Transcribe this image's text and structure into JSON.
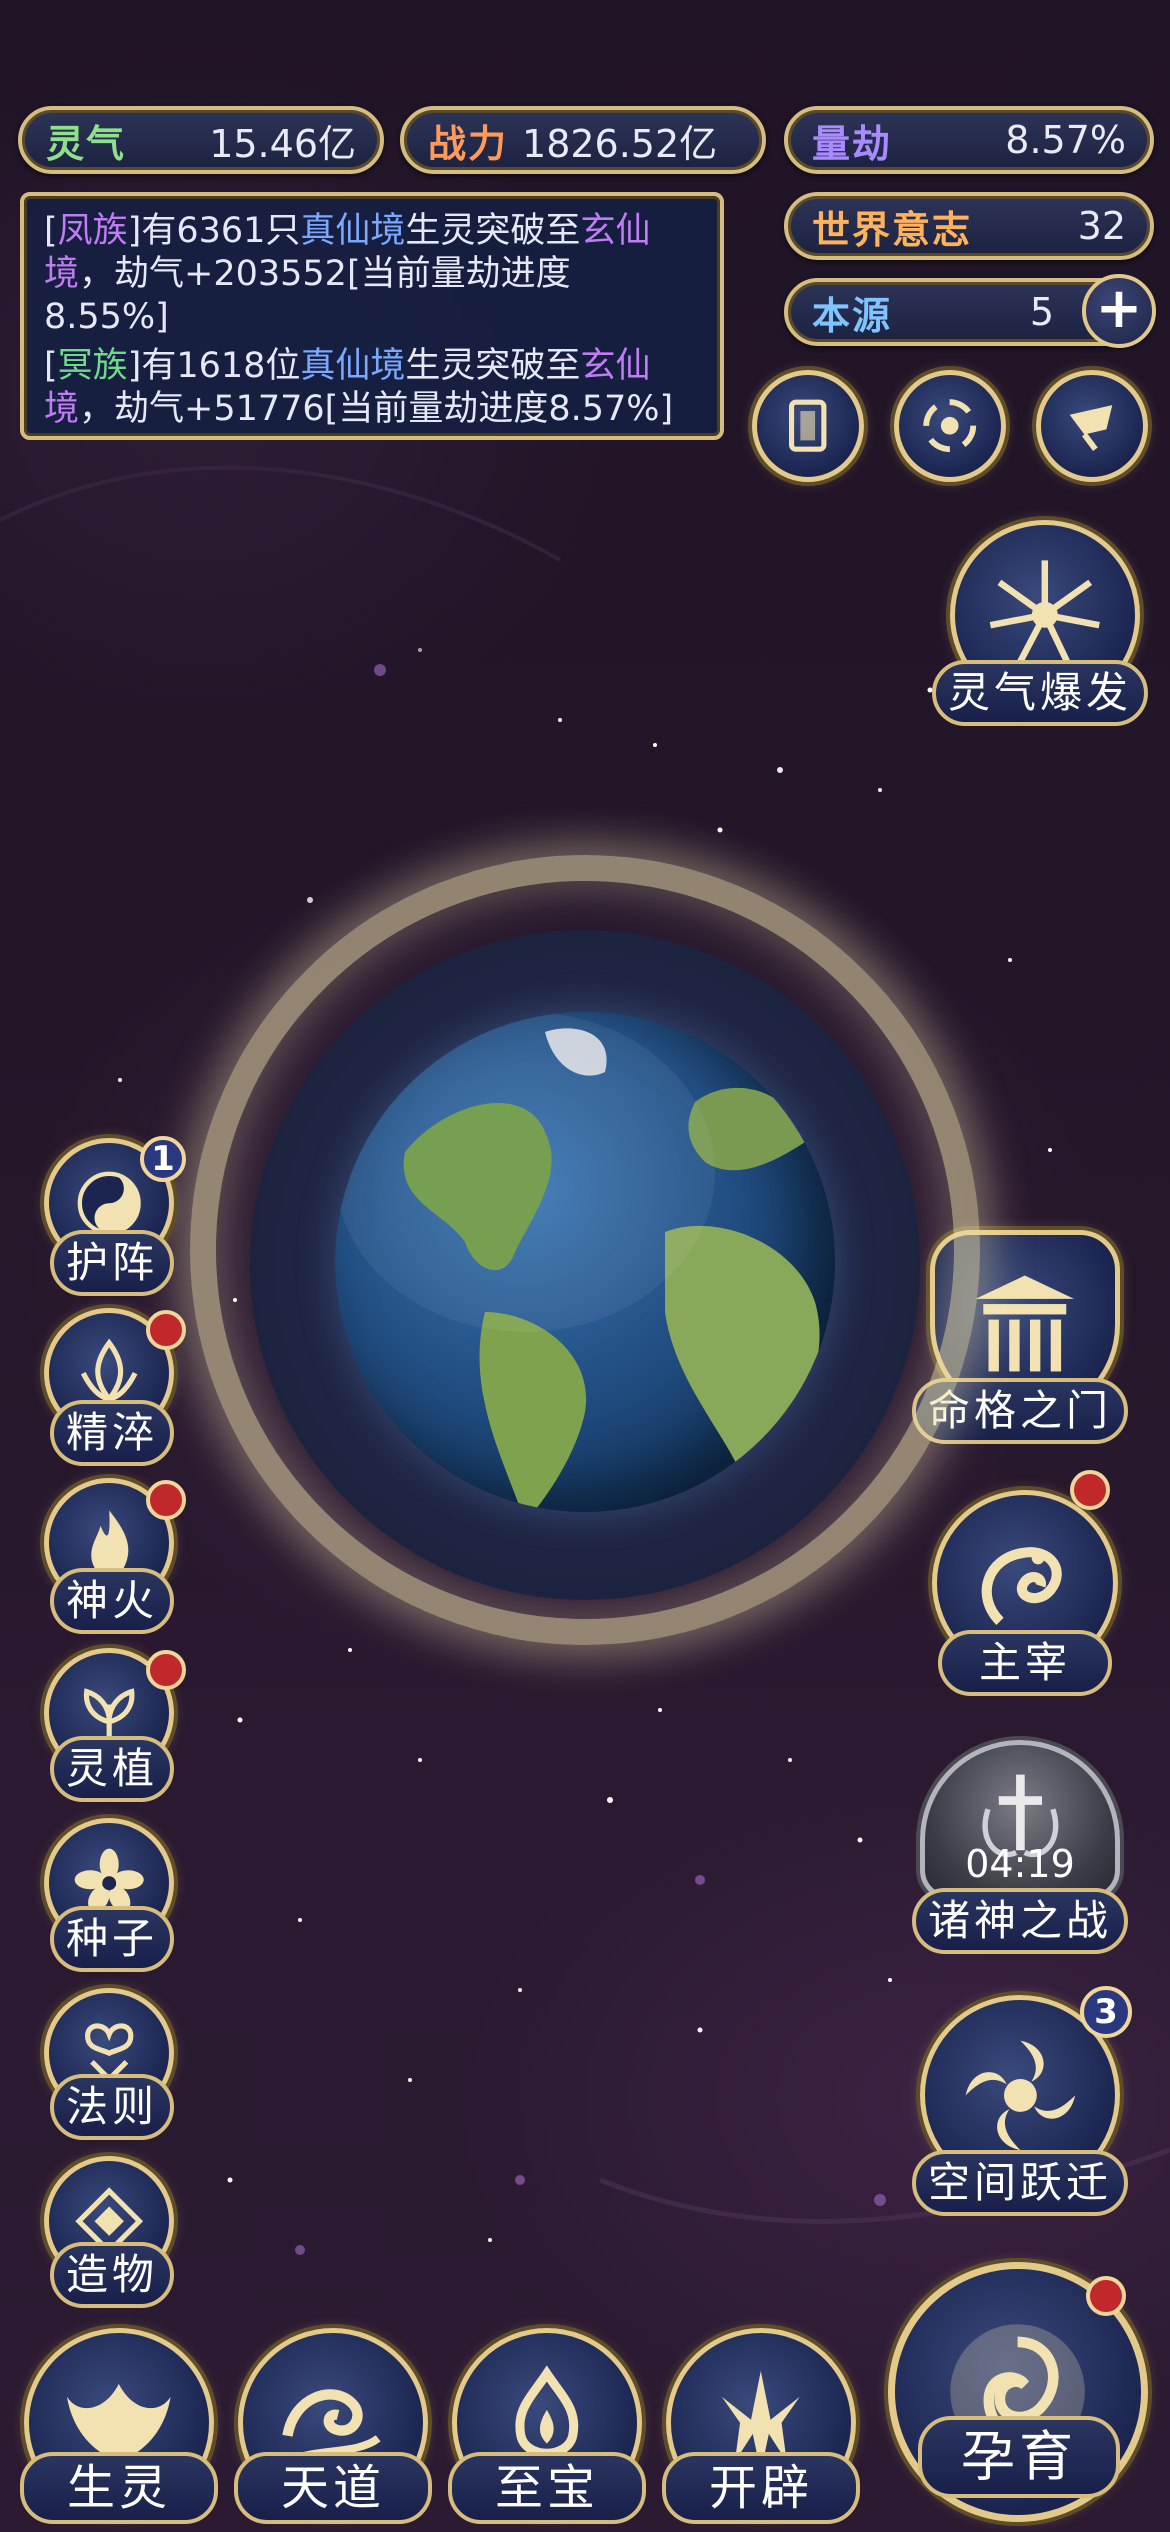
{
  "stats": {
    "lingqi": {
      "label": "灵气",
      "value": "15.46亿"
    },
    "zhanli": {
      "label": "战力",
      "value": "1826.52亿"
    },
    "liangjie": {
      "label": "量劫",
      "value": "8.57%"
    },
    "shijie": {
      "label": "世界意志",
      "value": "32"
    },
    "benyuan": {
      "label": "本源",
      "value": "5",
      "plus": "+"
    }
  },
  "messages": [
    {
      "bracket_open": "[",
      "race": "凤族",
      "bracket_close": "]",
      "t1": "有6361只",
      "realm1": "真仙境",
      "t2": "生灵突破至",
      "realm2": "玄仙",
      "realm2b": "境",
      "t3": "，劫气+203552[当前量劫进度",
      "t4": "8.55%]"
    },
    {
      "bracket_open": "[",
      "race": "冥族",
      "bracket_close": "]",
      "t1": "有1618位",
      "realm1": "真仙境",
      "t2": "生灵突破至",
      "realm2": "玄仙",
      "realm2b": "境",
      "t3": "，劫气+51776[当前量劫进度8.57%]"
    }
  ],
  "right_buttons": {
    "burst": "灵气爆发",
    "fate_gate": "命格之门",
    "ruler": "主宰",
    "gods_war": "诸神之战",
    "gods_war_timer": "04:19",
    "space_jump": "空间跃迁",
    "space_jump_badge": "3"
  },
  "left_buttons": [
    {
      "label": "护阵",
      "badge": "1"
    },
    {
      "label": "精淬"
    },
    {
      "label": "神火"
    },
    {
      "label": "灵植"
    },
    {
      "label": "种子"
    },
    {
      "label": "法则"
    },
    {
      "label": "造物"
    }
  ],
  "bottom_buttons": [
    "生灵",
    "天道",
    "至宝",
    "开辟",
    "孕育"
  ],
  "colors": {
    "gold": "#d7bd7d",
    "panel": "#1c2240",
    "badge_red": "#c0282c"
  }
}
